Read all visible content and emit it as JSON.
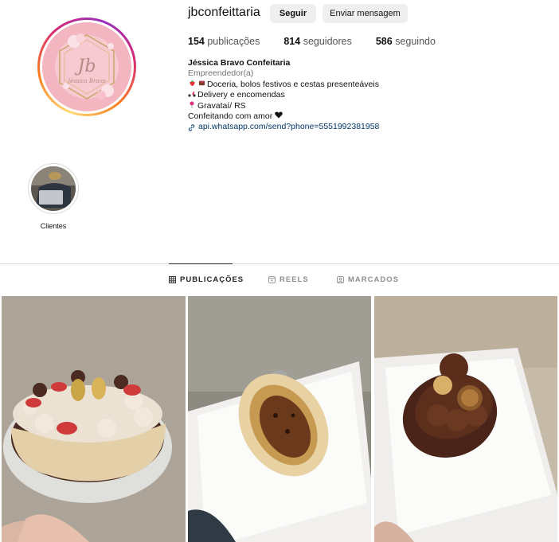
{
  "profile": {
    "username": "jbconfeittaria",
    "follow_label": "Seguir",
    "message_label": "Enviar mensagem",
    "logo_text": "Jb",
    "logo_subtext": "Jéssica Bravo"
  },
  "stats": {
    "posts_count": "154",
    "posts_label": "publicações",
    "followers_count": "814",
    "followers_label": "seguidores",
    "following_count": "586",
    "following_label": "seguindo"
  },
  "bio": {
    "name": "Jéssica Bravo Confeitaria",
    "category": "Empreendedor(a)",
    "line1": "Doceria, bolos festivos e cestas presenteáveis",
    "line2": "Delivery e encomendas",
    "line3": "Gravataí/ RS",
    "line4": "Confeitando com amor",
    "link": "api.whatsapp.com/send?phone=5551992381958"
  },
  "highlights": [
    {
      "label": "Clientes"
    }
  ],
  "tabs": [
    {
      "label": "PUBLICAÇÕES",
      "icon": "grid-icon",
      "active": true
    },
    {
      "label": "REELS",
      "icon": "reels-icon",
      "active": false
    },
    {
      "label": "MARCADOS",
      "icon": "tagged-icon",
      "active": false
    }
  ],
  "posts": [
    {
      "subject": "bolo"
    },
    {
      "subject": "ovo de colher maracujá"
    },
    {
      "subject": "ovo de chocolate"
    }
  ],
  "colors": {
    "link": "#00376b",
    "button_bg": "#efefef",
    "logo_pink": "#f4b7c1"
  }
}
